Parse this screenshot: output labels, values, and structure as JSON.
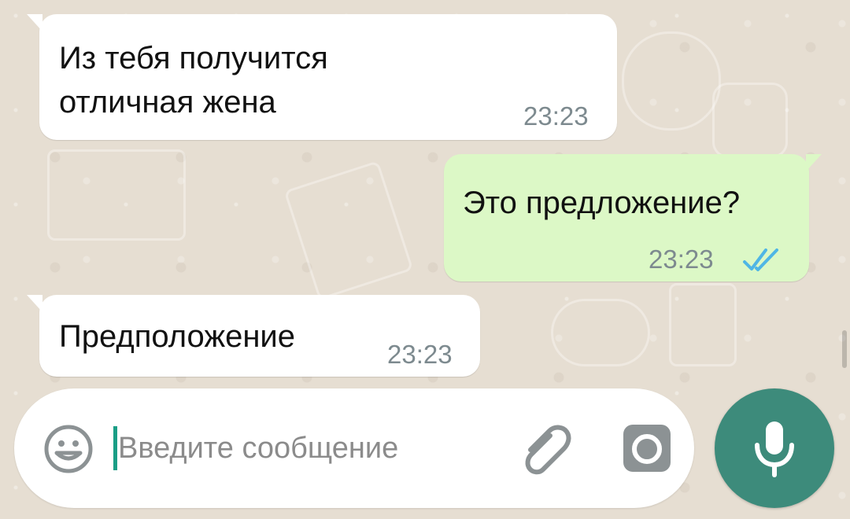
{
  "chat": {
    "messages": [
      {
        "direction": "incoming",
        "text": "Из тебя получится\nотличная жена",
        "time": "23:23"
      },
      {
        "direction": "outgoing",
        "text": "Это предложение?",
        "time": "23:23",
        "status": "read-double-check"
      },
      {
        "direction": "incoming",
        "text": "Предположение",
        "time": "23:23"
      }
    ]
  },
  "composer": {
    "placeholder": "Введите сообщение",
    "emoji_icon": "emoji-icon",
    "attach_icon": "paperclip-icon",
    "camera_icon": "camera-icon",
    "mic_icon": "microphone-icon"
  },
  "colors": {
    "wallpaper": "#e6ded2",
    "incoming_bubble": "#ffffff",
    "outgoing_bubble": "#dcf8c6",
    "timestamp": "#7d8a8f",
    "read_ticks": "#4fb6e5",
    "mic_button": "#3d8b7b",
    "caret": "#1a9e86"
  }
}
